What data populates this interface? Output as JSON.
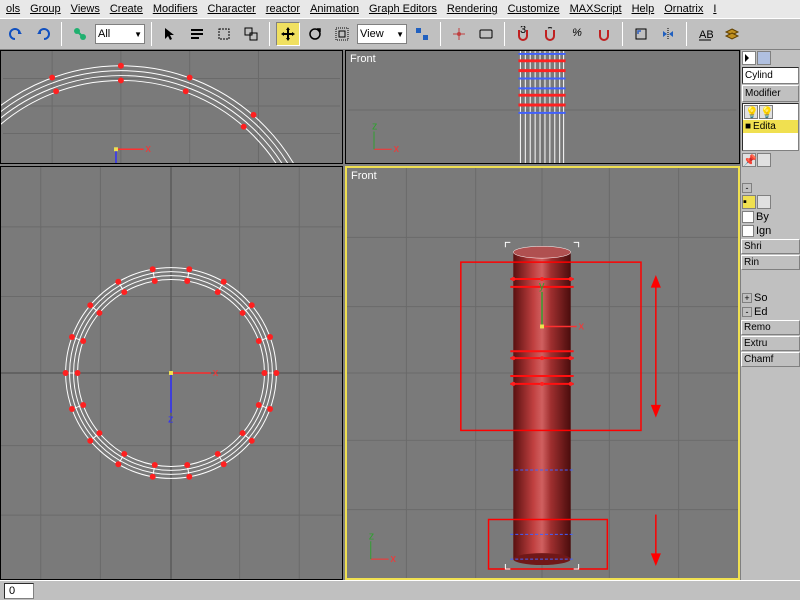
{
  "menu": [
    "ols",
    "Group",
    "Views",
    "Create",
    "Modifiers",
    "Character",
    "reactor",
    "Animation",
    "Graph Editors",
    "Rendering",
    "Customize",
    "MAXScript",
    "Help",
    "Ornatrix",
    "I"
  ],
  "toolbar": {
    "selection_set": "All",
    "ref_coord": "View"
  },
  "viewports": {
    "top_right_label": "Front",
    "bottom_right_label": "Front"
  },
  "panel": {
    "object_type": "Cylind",
    "modifier_label": "Modifier",
    "stack_item": "Edita",
    "by_label": "By",
    "ignore_label": "Ign",
    "shrink_btn": "Shri",
    "ring_btn": "Rin",
    "soft_btn": "So",
    "edit_btn": "Ed",
    "remove_btn": "Remo",
    "extrude_btn": "Extru",
    "chamfer_btn": "Chamf"
  },
  "status": {
    "frame": "0"
  },
  "colors": {
    "viewport_bg": "#7a7a7a",
    "grid": "#6a6a6a",
    "grid_major": "#5a5a5a",
    "vertex": "#ff2020",
    "edge_sel": "#ff0000",
    "wire": "#ffffff",
    "obj_fill": "#902020",
    "gizmo_x": "#ff3030",
    "gizmo_y": "#30a030",
    "gizmo_z": "#3030ff",
    "active_border": "#f0e050",
    "seg_marker": "#4060ff"
  }
}
